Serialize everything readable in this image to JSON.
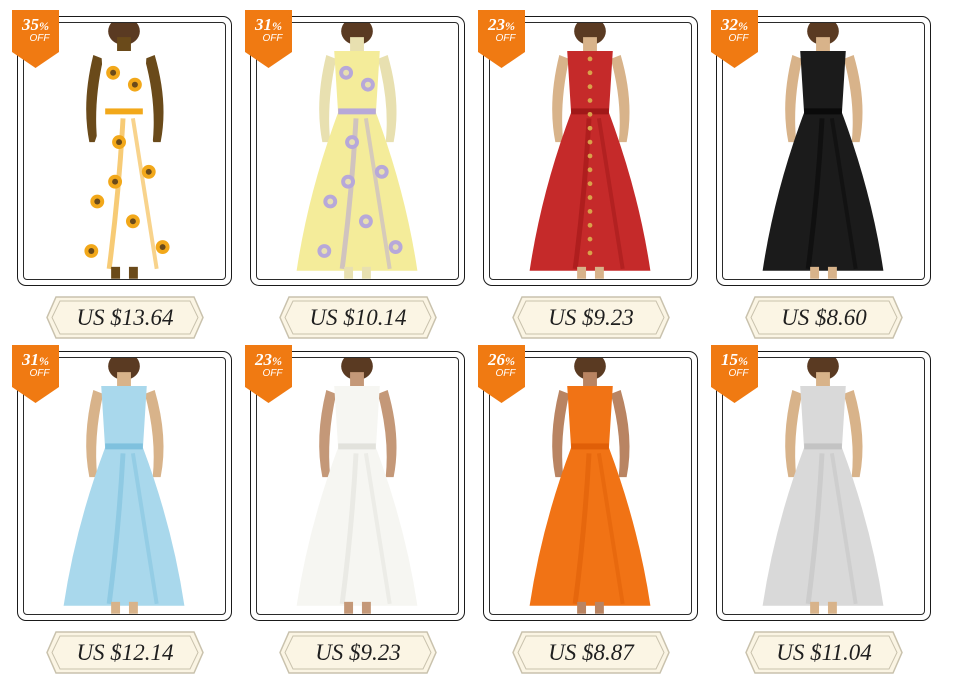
{
  "colors": {
    "badge": "#f07a12",
    "tag_fill": "#fbf5e4",
    "tag_border": "#c9c2ad",
    "frame": "#1a1a1a"
  },
  "products": [
    {
      "discount": "35",
      "off_label": "OFF",
      "price": "US $13.64",
      "dress": "sunflower-print-dress",
      "colors": [
        "#ffffff",
        "#f2a81a",
        "#6a4a1a"
      ]
    },
    {
      "discount": "31",
      "off_label": "OFF",
      "price": "US $10.14",
      "dress": "yellow-floral-dress",
      "colors": [
        "#f4ec9a",
        "#b7a8d9",
        "#e8e0b0"
      ]
    },
    {
      "discount": "23",
      "off_label": "OFF",
      "price": "US $9.23",
      "dress": "red-button-front-dress",
      "colors": [
        "#c52a2a",
        "#a01818",
        "#d8b38a"
      ]
    },
    {
      "discount": "32",
      "off_label": "OFF",
      "price": "US $8.60",
      "dress": "black-apron-dress",
      "colors": [
        "#1b1b1b",
        "#0a0a0a",
        "#d8b38a"
      ]
    },
    {
      "discount": "31",
      "off_label": "OFF",
      "price": "US $12.14",
      "dress": "light-blue-maxi-dress",
      "colors": [
        "#a9d8ec",
        "#7fc1de",
        "#d8b38a"
      ]
    },
    {
      "discount": "23",
      "off_label": "OFF",
      "price": "US $9.23",
      "dress": "white-sheer-maxi-dress",
      "colors": [
        "#f6f6f2",
        "#e2e2dc",
        "#c49878"
      ]
    },
    {
      "discount": "26",
      "off_label": "OFF",
      "price": "US $8.87",
      "dress": "orange-wrap-dress",
      "colors": [
        "#f17315",
        "#e05f08",
        "#b98462"
      ]
    },
    {
      "discount": "15",
      "off_label": "OFF",
      "price": "US $11.04",
      "dress": "silver-satin-maxi-dress",
      "colors": [
        "#d9d9d9",
        "#c3c3c3",
        "#d8b38a"
      ]
    }
  ]
}
